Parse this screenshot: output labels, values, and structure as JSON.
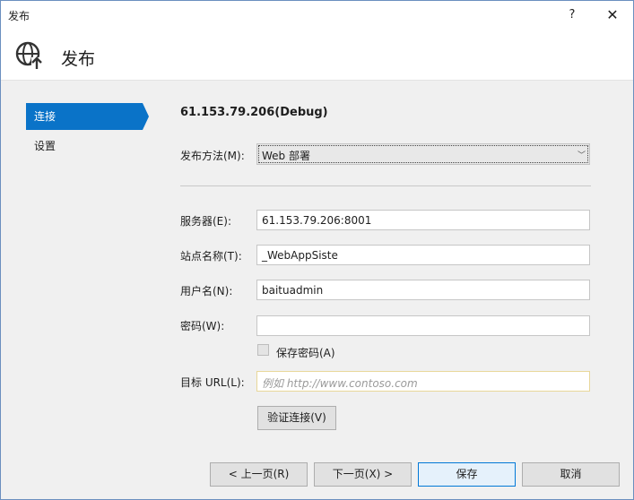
{
  "window": {
    "title": "发布",
    "help_label": "?",
    "close_label": "✕"
  },
  "header": {
    "title": "发布",
    "icon": "globe-publish-icon"
  },
  "sidebar": {
    "items": [
      {
        "label": "连接",
        "active": true
      },
      {
        "label": "设置",
        "active": false
      }
    ]
  },
  "main": {
    "profile_title": "61.153.79.206(Debug)",
    "publish_method": {
      "label": "发布方法(M):",
      "value": "Web 部署"
    },
    "server": {
      "label": "服务器(E):",
      "value": "61.153.79.206:8001"
    },
    "site_name": {
      "label": "站点名称(T):",
      "value": "_WebAppSiste"
    },
    "username": {
      "label": "用户名(N):",
      "value": "baituadmin"
    },
    "password": {
      "label": "密码(W):",
      "value": ""
    },
    "save_password": {
      "label": "保存密码(A)",
      "checked": false
    },
    "target_url": {
      "label": "目标 URL(L):",
      "value": "",
      "placeholder": "例如 http://www.contoso.com"
    },
    "validate_button": "验证连接(V)"
  },
  "footer": {
    "prev": "< 上一页(R)",
    "next": "下一页(X) >",
    "save": "保存",
    "cancel": "取消"
  }
}
